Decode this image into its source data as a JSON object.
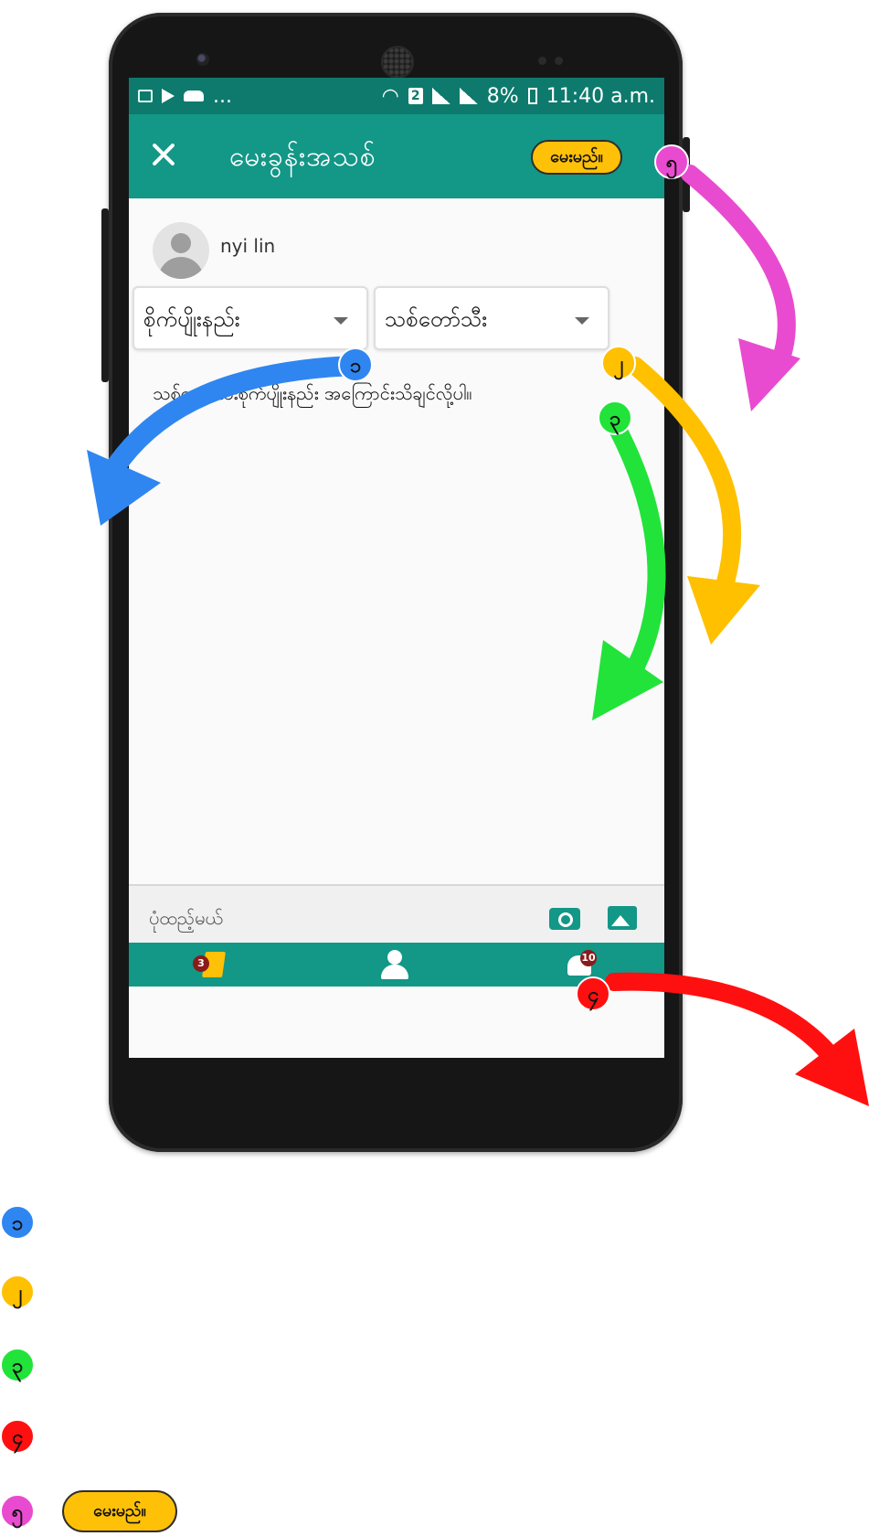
{
  "status_bar": {
    "network_badge": "2",
    "battery": "8%",
    "time": "11:40 a.m.",
    "overflow": "..."
  },
  "app_bar": {
    "title": "မေးခွန်းအသစ်",
    "ask_button": "မေးမည်။"
  },
  "user": {
    "name": "nyi lin"
  },
  "dropdowns": {
    "method": "စိုက်ပျိုးနည်း",
    "crop": "သစ်တော်သီး"
  },
  "question_text": "သစ်တော်သီးစိုက်ပျိုးနည်း အကြောင်းသိချင်လို့ပါ။",
  "tools": {
    "add_photo_label": "ပုံထည့်မယ်"
  },
  "bottom_nav": {
    "notes_count": "3",
    "notifications_count": "10"
  },
  "markers": {
    "m1": "၁",
    "m2": "၂",
    "m3": "၃",
    "m4": "၄",
    "m5": "၅"
  },
  "legend": {
    "ask_button": "မေးမည်။"
  },
  "colors": {
    "teal": "#139787",
    "teal_dark": "#0d7a6d",
    "accent": "#ffc107",
    "blue": "#2f86f0",
    "yellow": "#ffc000",
    "green": "#22e33a",
    "red": "#ff1010",
    "magenta": "#e94bd0"
  }
}
